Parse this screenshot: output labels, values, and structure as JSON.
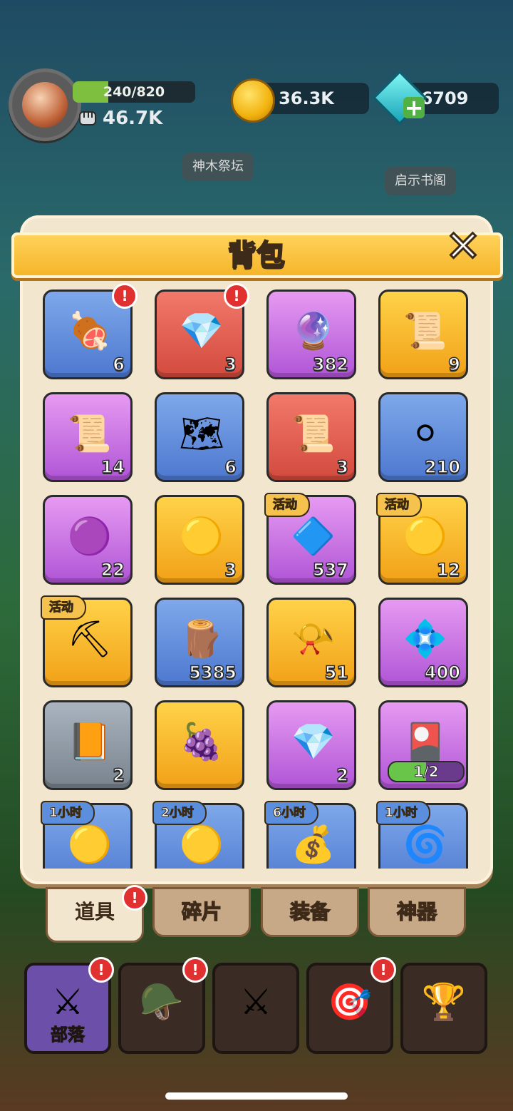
{
  "hud": {
    "xp_text": "240/820",
    "xp_progress": 0.29,
    "power": "46.7K",
    "coins": "36.3K",
    "gems": "6709",
    "map_label_1": "神木祭坛",
    "map_label_2": "启示书阁"
  },
  "panel": {
    "title": "背包",
    "close_label": "✕",
    "items": [
      {
        "icon": "meat-icon",
        "glyph": "🍖",
        "color": "blue",
        "count": "6",
        "alert": true
      },
      {
        "icon": "gem-chest-icon",
        "glyph": "💎",
        "color": "red",
        "count": "3",
        "alert": true
      },
      {
        "icon": "purple-gem-icon",
        "glyph": "🔮",
        "color": "purple",
        "count": "382"
      },
      {
        "icon": "scroll-icon",
        "glyph": "📜",
        "color": "yellow",
        "count": "9"
      },
      {
        "icon": "horned-scroll-icon",
        "glyph": "📜",
        "color": "purple",
        "count": "14"
      },
      {
        "icon": "map-scroll-icon",
        "glyph": "🗺",
        "color": "blue",
        "count": "6"
      },
      {
        "icon": "purple-scroll-icon",
        "glyph": "📜",
        "color": "red",
        "count": "3"
      },
      {
        "icon": "silver-coin-icon",
        "glyph": "⚪",
        "color": "blue",
        "count": "210"
      },
      {
        "icon": "purple-coin-icon",
        "glyph": "🟣",
        "color": "purple",
        "count": "22"
      },
      {
        "icon": "gold-coin-icon",
        "glyph": "🟡",
        "color": "yellow",
        "count": "3"
      },
      {
        "icon": "blue-crystal-icon",
        "glyph": "🔷",
        "color": "purple",
        "count": "537",
        "tag": "活动"
      },
      {
        "icon": "event-coin-icon",
        "glyph": "🟡",
        "color": "yellow",
        "count": "12",
        "tag": "活动"
      },
      {
        "icon": "pickaxe-icon",
        "glyph": "⛏",
        "color": "yellow",
        "count": "",
        "tag": "活动"
      },
      {
        "icon": "wood-log-icon",
        "glyph": "🪵",
        "color": "blue",
        "count": "5385"
      },
      {
        "icon": "horn-icon",
        "glyph": "📯",
        "color": "yellow",
        "count": "51"
      },
      {
        "icon": "purple-ore-icon",
        "glyph": "💠",
        "color": "purple",
        "count": "400"
      },
      {
        "icon": "speedup-book-icon",
        "glyph": "📙",
        "color": "gray",
        "count": "2"
      },
      {
        "icon": "berry-icon",
        "glyph": "🍇",
        "color": "yellow",
        "count": ""
      },
      {
        "icon": "crystal-shard-icon",
        "glyph": "💎",
        "color": "purple",
        "count": "2"
      },
      {
        "icon": "card-icon",
        "glyph": "🎴",
        "color": "purple",
        "count": "",
        "progress_text": "1/2",
        "progress": 0.5
      },
      {
        "icon": "gold-coin-icon",
        "glyph": "🟡",
        "color": "blue",
        "count": "",
        "tag": "1小时",
        "tag_blue": true
      },
      {
        "icon": "gold-coin-icon",
        "glyph": "🟡",
        "color": "blue",
        "count": "",
        "tag": "2小时",
        "tag_blue": true
      },
      {
        "icon": "coin-sack-icon",
        "glyph": "💰",
        "color": "blue",
        "count": "",
        "tag": "6小时",
        "tag_blue": true
      },
      {
        "icon": "blue-swirl-icon",
        "glyph": "🌀",
        "color": "blue",
        "count": "",
        "tag": "1小时",
        "tag_blue": true
      }
    ]
  },
  "tabs": [
    {
      "label": "道具",
      "active": true,
      "alert": true
    },
    {
      "label": "碎片",
      "active": false
    },
    {
      "label": "装备",
      "active": false
    },
    {
      "label": "神器",
      "active": false
    }
  ],
  "nav": [
    {
      "icon": "banner-sword-icon",
      "glyph": "⚔",
      "label": "部落",
      "active": true,
      "alert": true
    },
    {
      "icon": "viking-helmet-icon",
      "glyph": "🪖",
      "label": "",
      "alert": true
    },
    {
      "icon": "crossed-swords-icon",
      "glyph": "⚔",
      "label": ""
    },
    {
      "icon": "target-icon",
      "glyph": "🎯",
      "label": "",
      "alert": true
    },
    {
      "icon": "trophy-icon",
      "glyph": "🏆",
      "label": ""
    }
  ],
  "colors": {
    "blue": "#6a93e0",
    "red": "#e56050",
    "purple": "#c878e6",
    "yellow": "#f8c02e",
    "gray": "#96a0ab"
  }
}
